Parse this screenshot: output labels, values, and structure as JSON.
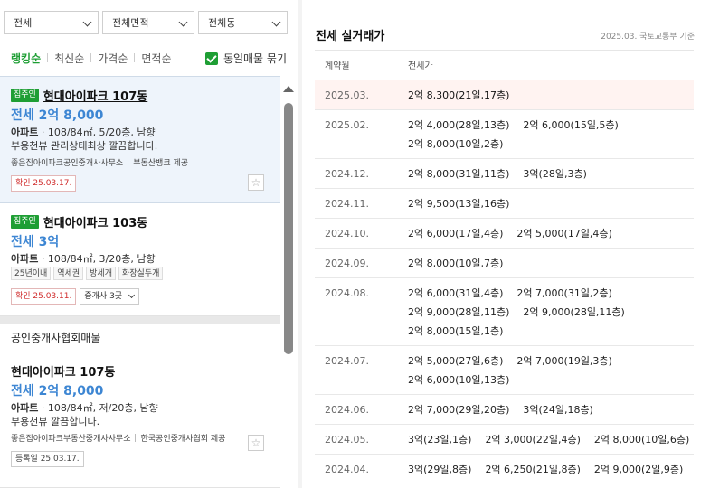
{
  "filters": [
    "전세",
    "전체면적",
    "전체동"
  ],
  "sort": {
    "items": [
      "랭킹순",
      "최신순",
      "가격순",
      "면적순"
    ],
    "active": "랭킹순",
    "same_merge_label": "동일매물 묶기",
    "same_merge_checked": true
  },
  "listings": [
    {
      "owner_tag": "집주인",
      "title": "현대아이파크 107동",
      "price": "전세 2억 8,000",
      "spec_type": "아파트",
      "spec_rest": " · 108/84㎡, 5/20층, 남향",
      "desc": "부용천뷰 관리상태최상 깔끔합니다.",
      "source1": "좋은집아이파크공인중개사사무소",
      "source2": "부동산뱅크 제공",
      "confirm": "확인 25.03.17."
    },
    {
      "owner_tag": "집주인",
      "title": "현대아이파크 103동",
      "price": "전세 3억",
      "spec_type": "아파트",
      "spec_rest": " · 108/84㎡, 3/20층, 남향",
      "tags": [
        "25년이내",
        "역세권",
        "방세개",
        "화장실두개"
      ],
      "confirm": "확인 25.03.11.",
      "agents": "중개사 3곳"
    },
    {
      "title": "현대아이파크 107동",
      "price": "전세 2억 8,000",
      "spec_type": "아파트",
      "spec_rest": " · 108/84㎡, 저/20층, 남향",
      "desc": "부용천뷰 깔끔합니다.",
      "source1": "좋은집아이파크부동산중개사사무소",
      "source2": "한국공인중개사협회 제공",
      "regdate": "등록일 25.03.17."
    }
  ],
  "section_title": "공인중개사협회매물",
  "trades": {
    "title": "전세 실거래가",
    "source": "2025.03. 국토교통부 기준",
    "col_date": "계약월",
    "col_price": "전세가",
    "rows": [
      {
        "month": "2025.03.",
        "lines": [
          [
            "2억 8,300(21일,17층)"
          ]
        ],
        "highlight": true
      },
      {
        "month": "2025.02.",
        "lines": [
          [
            "2억 4,000(28일,13층)",
            "2억 6,000(15일,5층)"
          ],
          [
            "2억 8,000(10일,2층)"
          ]
        ]
      },
      {
        "month": "2024.12.",
        "lines": [
          [
            "2억 8,000(31일,11층)",
            "3억(28일,3층)"
          ]
        ]
      },
      {
        "month": "2024.11.",
        "lines": [
          [
            "2억 9,500(13일,16층)"
          ]
        ]
      },
      {
        "month": "2024.10.",
        "lines": [
          [
            "2억 6,000(17일,4층)",
            "2억 5,000(17일,4층)"
          ]
        ]
      },
      {
        "month": "2024.09.",
        "lines": [
          [
            "2억 8,000(10일,7층)"
          ]
        ]
      },
      {
        "month": "2024.08.",
        "lines": [
          [
            "2억 6,000(31일,4층)",
            "2억 7,000(31일,2층)"
          ],
          [
            "2억 9,000(28일,11층)",
            "2억 9,000(28일,11층)"
          ],
          [
            "2억 8,000(15일,1층)"
          ]
        ]
      },
      {
        "month": "2024.07.",
        "lines": [
          [
            "2억 5,000(27일,6층)",
            "2억 7,000(19일,3층)"
          ],
          [
            "2억 6,000(10일,13층)"
          ]
        ]
      },
      {
        "month": "2024.06.",
        "lines": [
          [
            "2억 7,000(29일,20층)",
            "3억(24일,18층)"
          ]
        ]
      },
      {
        "month": "2024.05.",
        "lines": [
          [
            "3억(23일,1층)",
            "2억 3,000(22일,4층)",
            "2억 8,000(10일,6층)"
          ]
        ]
      },
      {
        "month": "2024.04.",
        "lines": [
          [
            "3억(29일,8층)",
            "2억 6,250(21일,8층)",
            "2억 9,000(2일,9층)"
          ]
        ]
      }
    ]
  },
  "colors": {
    "accent_green": "#1e9e34",
    "price_blue": "#3d86d3",
    "confirm_red": "#d02c2c",
    "highlight_row": "#fff3f1"
  },
  "icons": {
    "star": "☆"
  }
}
